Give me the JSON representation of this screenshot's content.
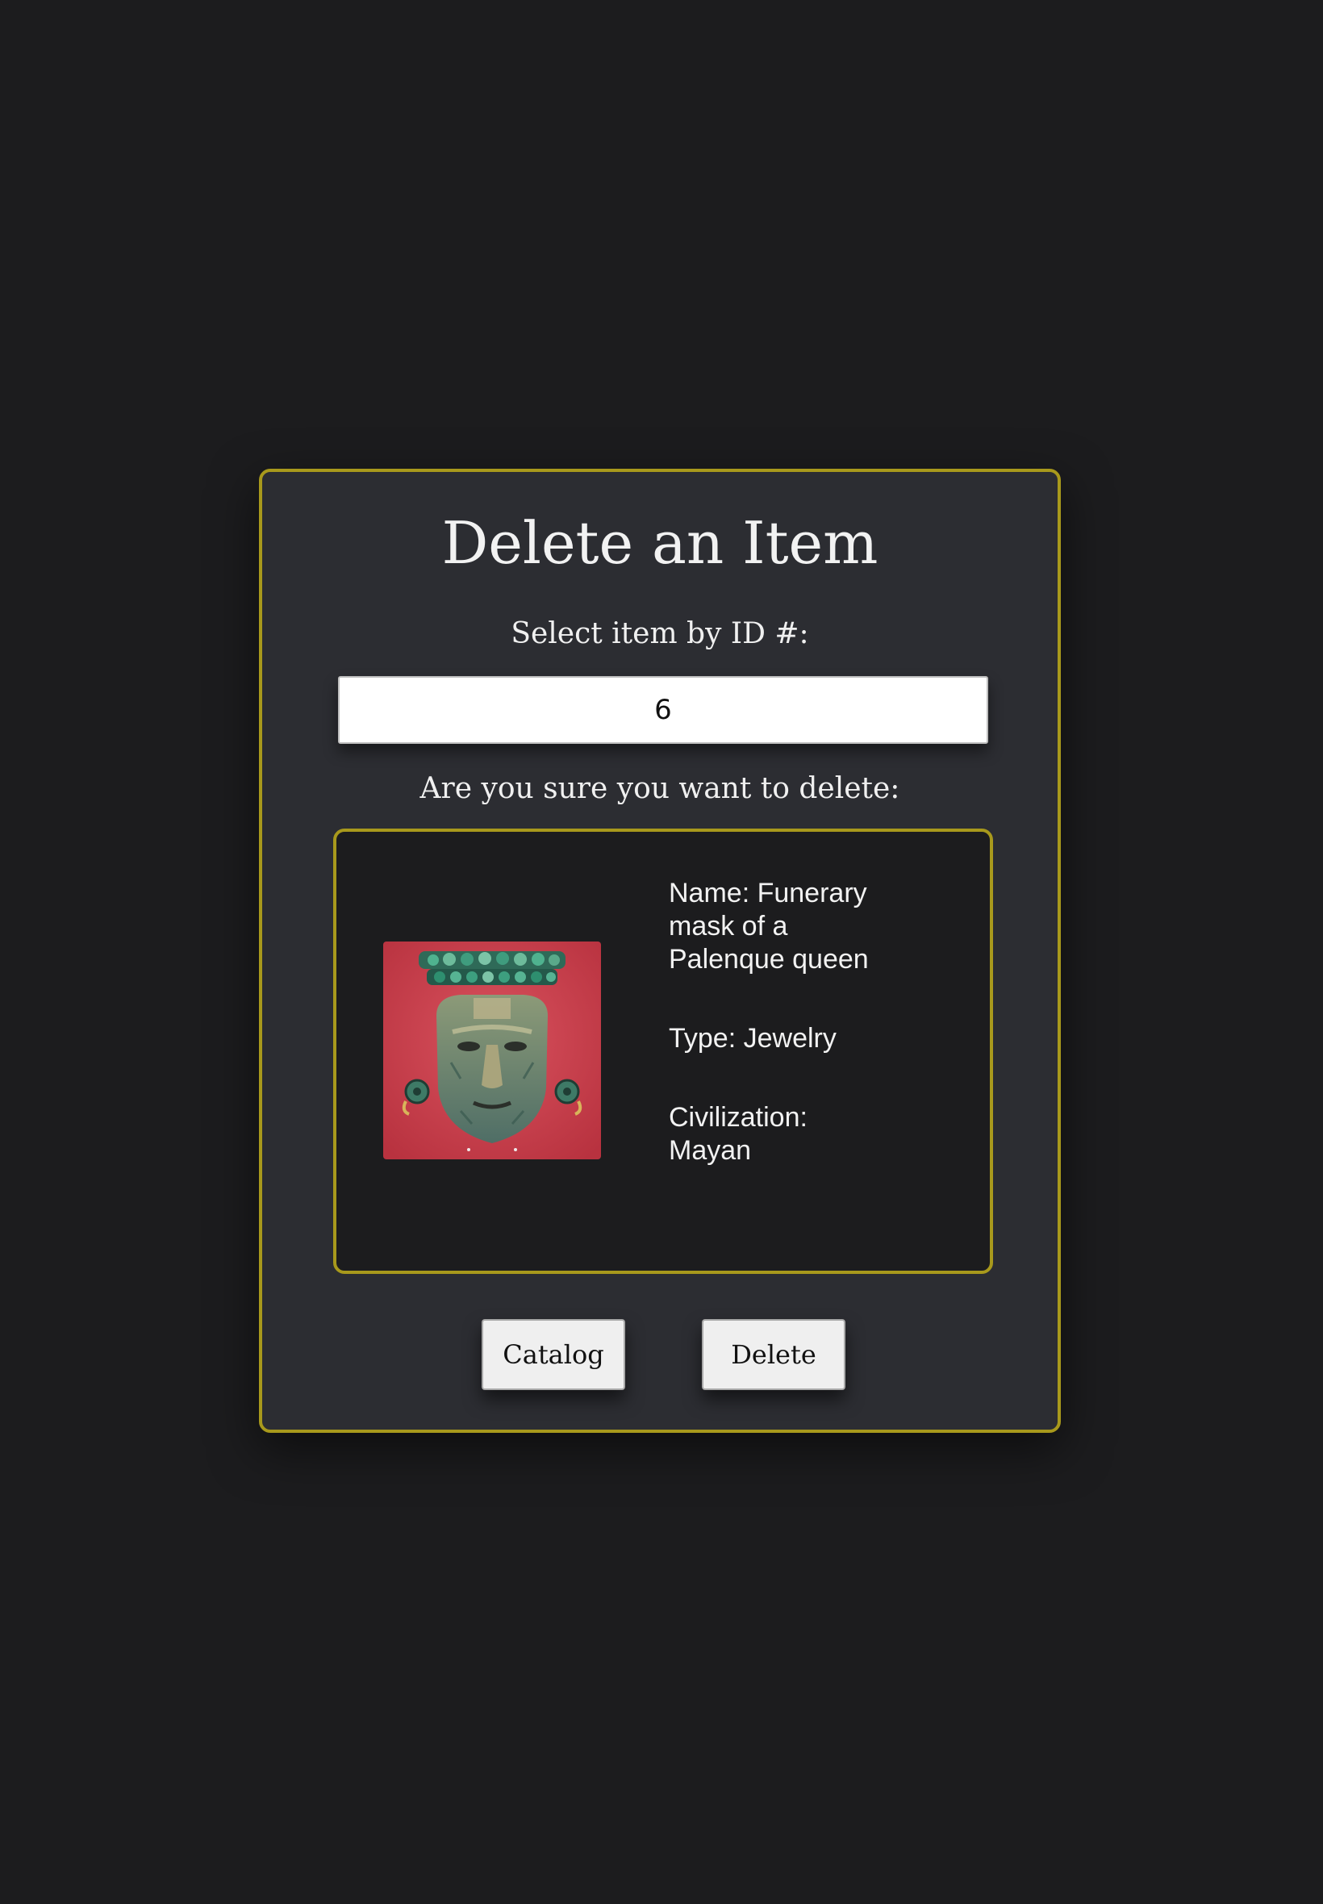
{
  "page": {
    "title": "Delete an Item",
    "select_label": "Select item by ID #:",
    "confirm_label": "Are you sure you want to delete:"
  },
  "id_field": {
    "value": "6"
  },
  "item": {
    "name_line": "Name: Funerary mask of a Palenque queen",
    "type_line": "Type: Jewelry",
    "civilization_line": "Civilization: Mayan",
    "image_subject": "Funerary mask of a Palenque queen"
  },
  "buttons": {
    "catalog_label": "Catalog",
    "delete_label": "Delete"
  },
  "colors": {
    "page_background": "#1c1c1e",
    "card_background": "#2c2d32",
    "accent_border": "#a8991c",
    "button_background": "#efefef"
  }
}
